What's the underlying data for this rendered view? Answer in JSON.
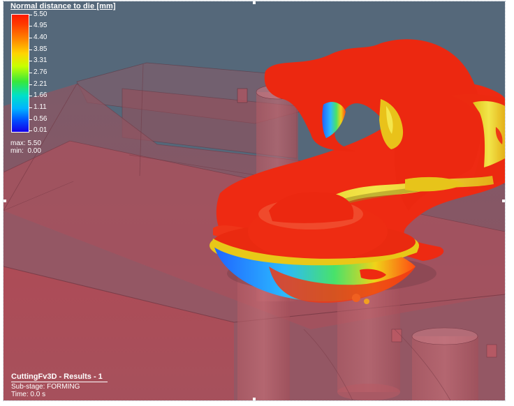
{
  "legend": {
    "title": "Normal distance to die [mm]",
    "ticks": [
      "5.50",
      "4.95",
      "4.40",
      "3.85",
      "3.31",
      "2.76",
      "2.21",
      "1.66",
      "1.11",
      "0.56",
      "0.01"
    ],
    "max_label": "max:",
    "max_value": "5.50",
    "min_label": "min:",
    "min_value": "0.00"
  },
  "footer": {
    "title": "CuttingFv3D - Results - 1",
    "substage": "Sub-stage: FORMING",
    "time": "Time: 0.0 s"
  },
  "colors": {
    "viewport_background": "#55687a",
    "die_fill": "#a84a56",
    "part_red": "#ee2a10",
    "part_yellow": "#e8d21c",
    "part_blue": "#2a6cff"
  }
}
